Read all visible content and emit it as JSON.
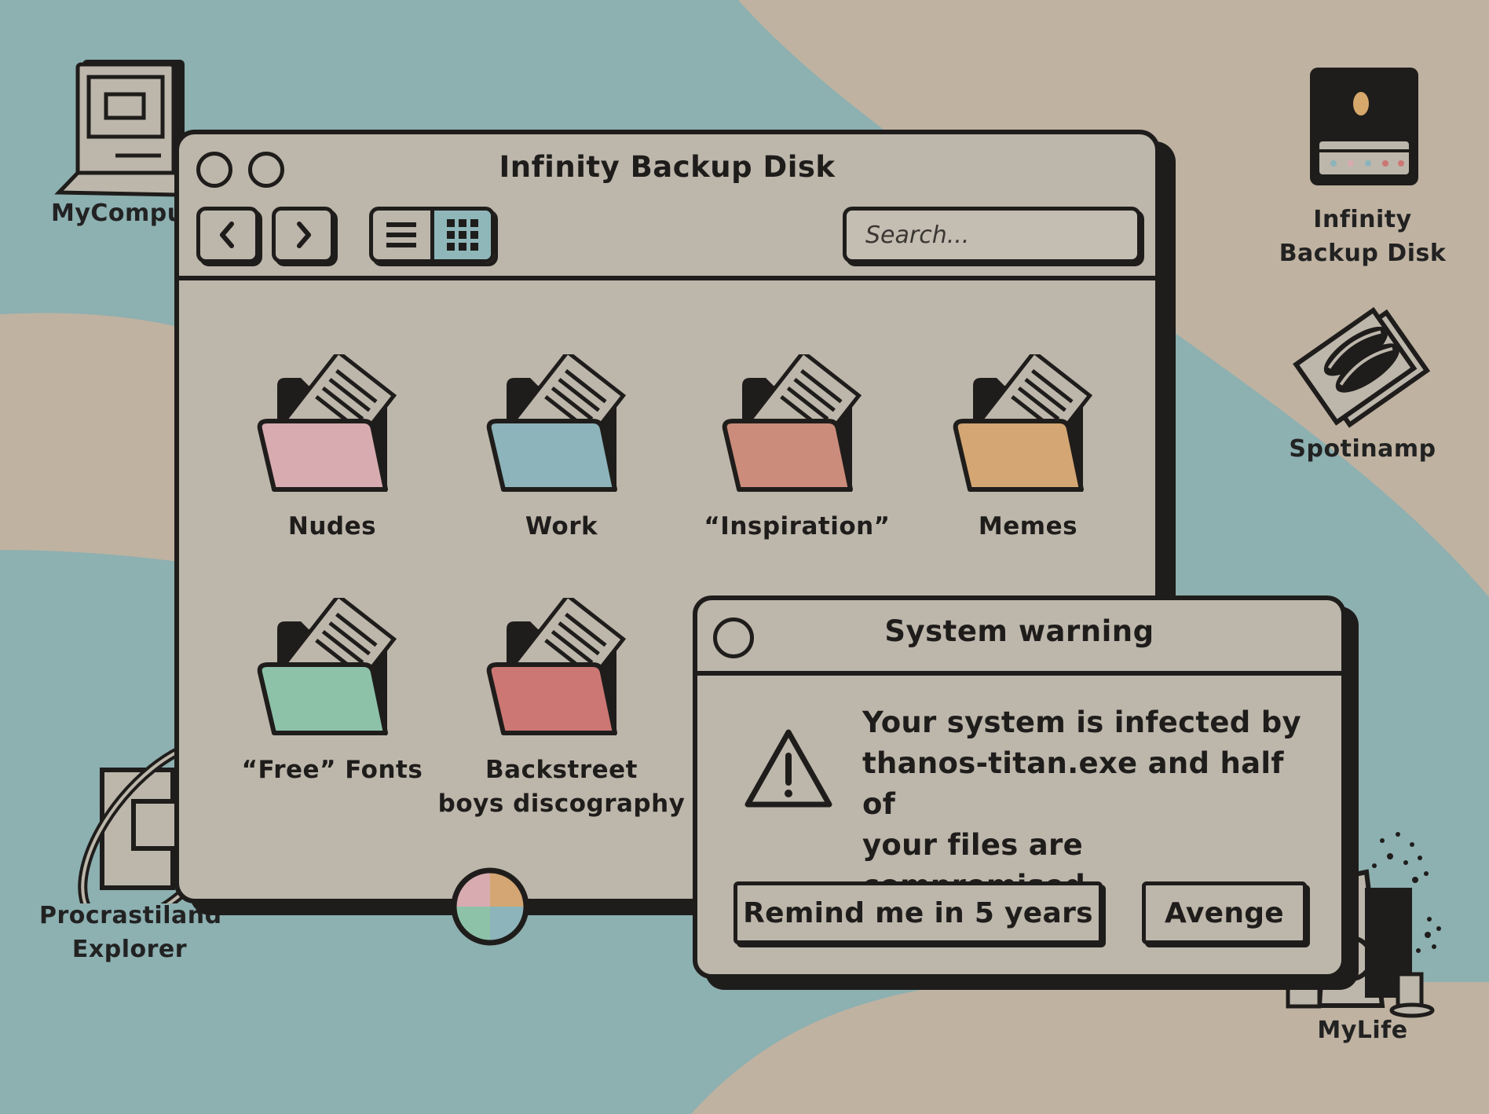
{
  "desktop": {
    "colors": {
      "teal": "#8db0b1",
      "sand": "#bfb2a1",
      "ink": "#1f1d1b",
      "panel": "#bdb6ab"
    },
    "icons": [
      {
        "label": "MyCompu",
        "icon": "computer-icon"
      },
      {
        "label": "Infinity Backup Disk",
        "icon": "disk-drive-icon"
      },
      {
        "label": "Spotinamp",
        "icon": "music-player-icon"
      },
      {
        "label": "Procrastiland Explorer",
        "icon": "browser-icon"
      },
      {
        "label": "MyLife",
        "icon": "trash-can-icon"
      }
    ]
  },
  "window": {
    "title": "Infinity Backup Disk",
    "search_placeholder": "Search...",
    "view_mode": "grid",
    "folders": [
      {
        "label": "Nudes",
        "color": "#d7abb0"
      },
      {
        "label": "Work",
        "color": "#8cb4ba"
      },
      {
        "label": "“Inspiration”",
        "color": "#cc8c7c"
      },
      {
        "label": "Memes",
        "color": "#d3a673"
      },
      {
        "label": "“Free” Fonts",
        "color": "#8dc2a8"
      },
      {
        "label": "Backstreet boys discography",
        "label_line1": "Backstreet",
        "label_line2": "boys discography",
        "color": "#cc7774"
      }
    ]
  },
  "dialog": {
    "title": "System warning",
    "message_line1": "Your system is infected by",
    "message_line2": "thanos-titan.exe and half of",
    "message_line3": "your files are compromised.",
    "remind_button": "Remind me in 5 years",
    "avenge_button": "Avenge"
  }
}
